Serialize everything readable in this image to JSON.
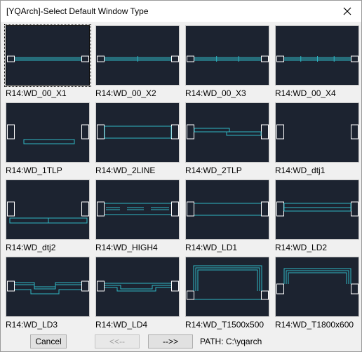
{
  "window": {
    "title": "[YQArch]-Select Default Window Type"
  },
  "items": [
    {
      "label": "R14:WD_00_X1",
      "kind": "x1",
      "selected": true
    },
    {
      "label": "R14:WD_00_X2",
      "kind": "x2"
    },
    {
      "label": "R14:WD_00_X3",
      "kind": "x3"
    },
    {
      "label": "R14:WD_00_X4",
      "kind": "x4"
    },
    {
      "label": "R14:WD_1TLP",
      "kind": "tlp1"
    },
    {
      "label": "R14:WD_2LINE",
      "kind": "line2"
    },
    {
      "label": "R14:WD_2TLP",
      "kind": "tlp2"
    },
    {
      "label": "R14:WD_dtj1",
      "kind": "dtj1"
    },
    {
      "label": "R14:WD_dtj2",
      "kind": "dtj2"
    },
    {
      "label": "R14:WD_HIGH4",
      "kind": "high4"
    },
    {
      "label": "R14:WD_LD1",
      "kind": "ld1"
    },
    {
      "label": "R14:WD_LD2",
      "kind": "ld2"
    },
    {
      "label": "R14:WD_LD3",
      "kind": "ld3"
    },
    {
      "label": "R14:WD_LD4",
      "kind": "ld4"
    },
    {
      "label": "R14:WD_T1500x500",
      "kind": "t1500"
    },
    {
      "label": "R14:WD_T1800x600",
      "kind": "t1800"
    }
  ],
  "footer": {
    "cancel_label": "Cancel",
    "prev_label": "<<--",
    "next_label": "-->>",
    "path_text": "PATH: C:\\yqarch"
  },
  "colors": {
    "thumb_bg": "#1c2330",
    "line": "#2fb7c4",
    "wall": "#ffffff"
  },
  "icons": {
    "close": "close-icon"
  }
}
